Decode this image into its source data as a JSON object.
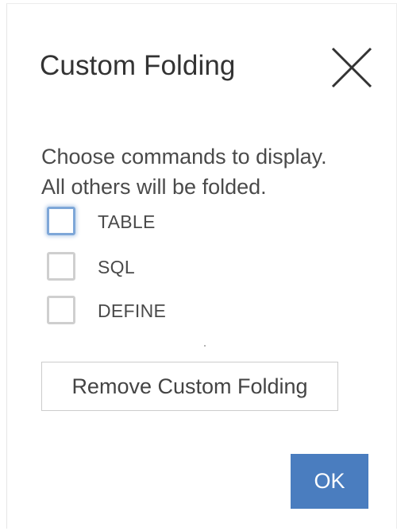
{
  "dialog": {
    "title": "Custom Folding",
    "close_icon": "close-icon",
    "instructions": {
      "line1": "Choose commands to display.",
      "line2": "All others will be folded."
    },
    "options": [
      {
        "label": "TABLE",
        "checked": false,
        "focused": true
      },
      {
        "label": "SQL",
        "checked": false,
        "focused": false
      },
      {
        "label": "DEFINE",
        "checked": false,
        "focused": false
      }
    ],
    "remove_button_label": "Remove Custom Folding",
    "ok_button_label": "OK"
  },
  "colors": {
    "accent": "#4a7dbf",
    "focus_ring": "#7ea7d8",
    "checkbox_border": "#cfcfcf",
    "text": "#4a4a4a"
  }
}
